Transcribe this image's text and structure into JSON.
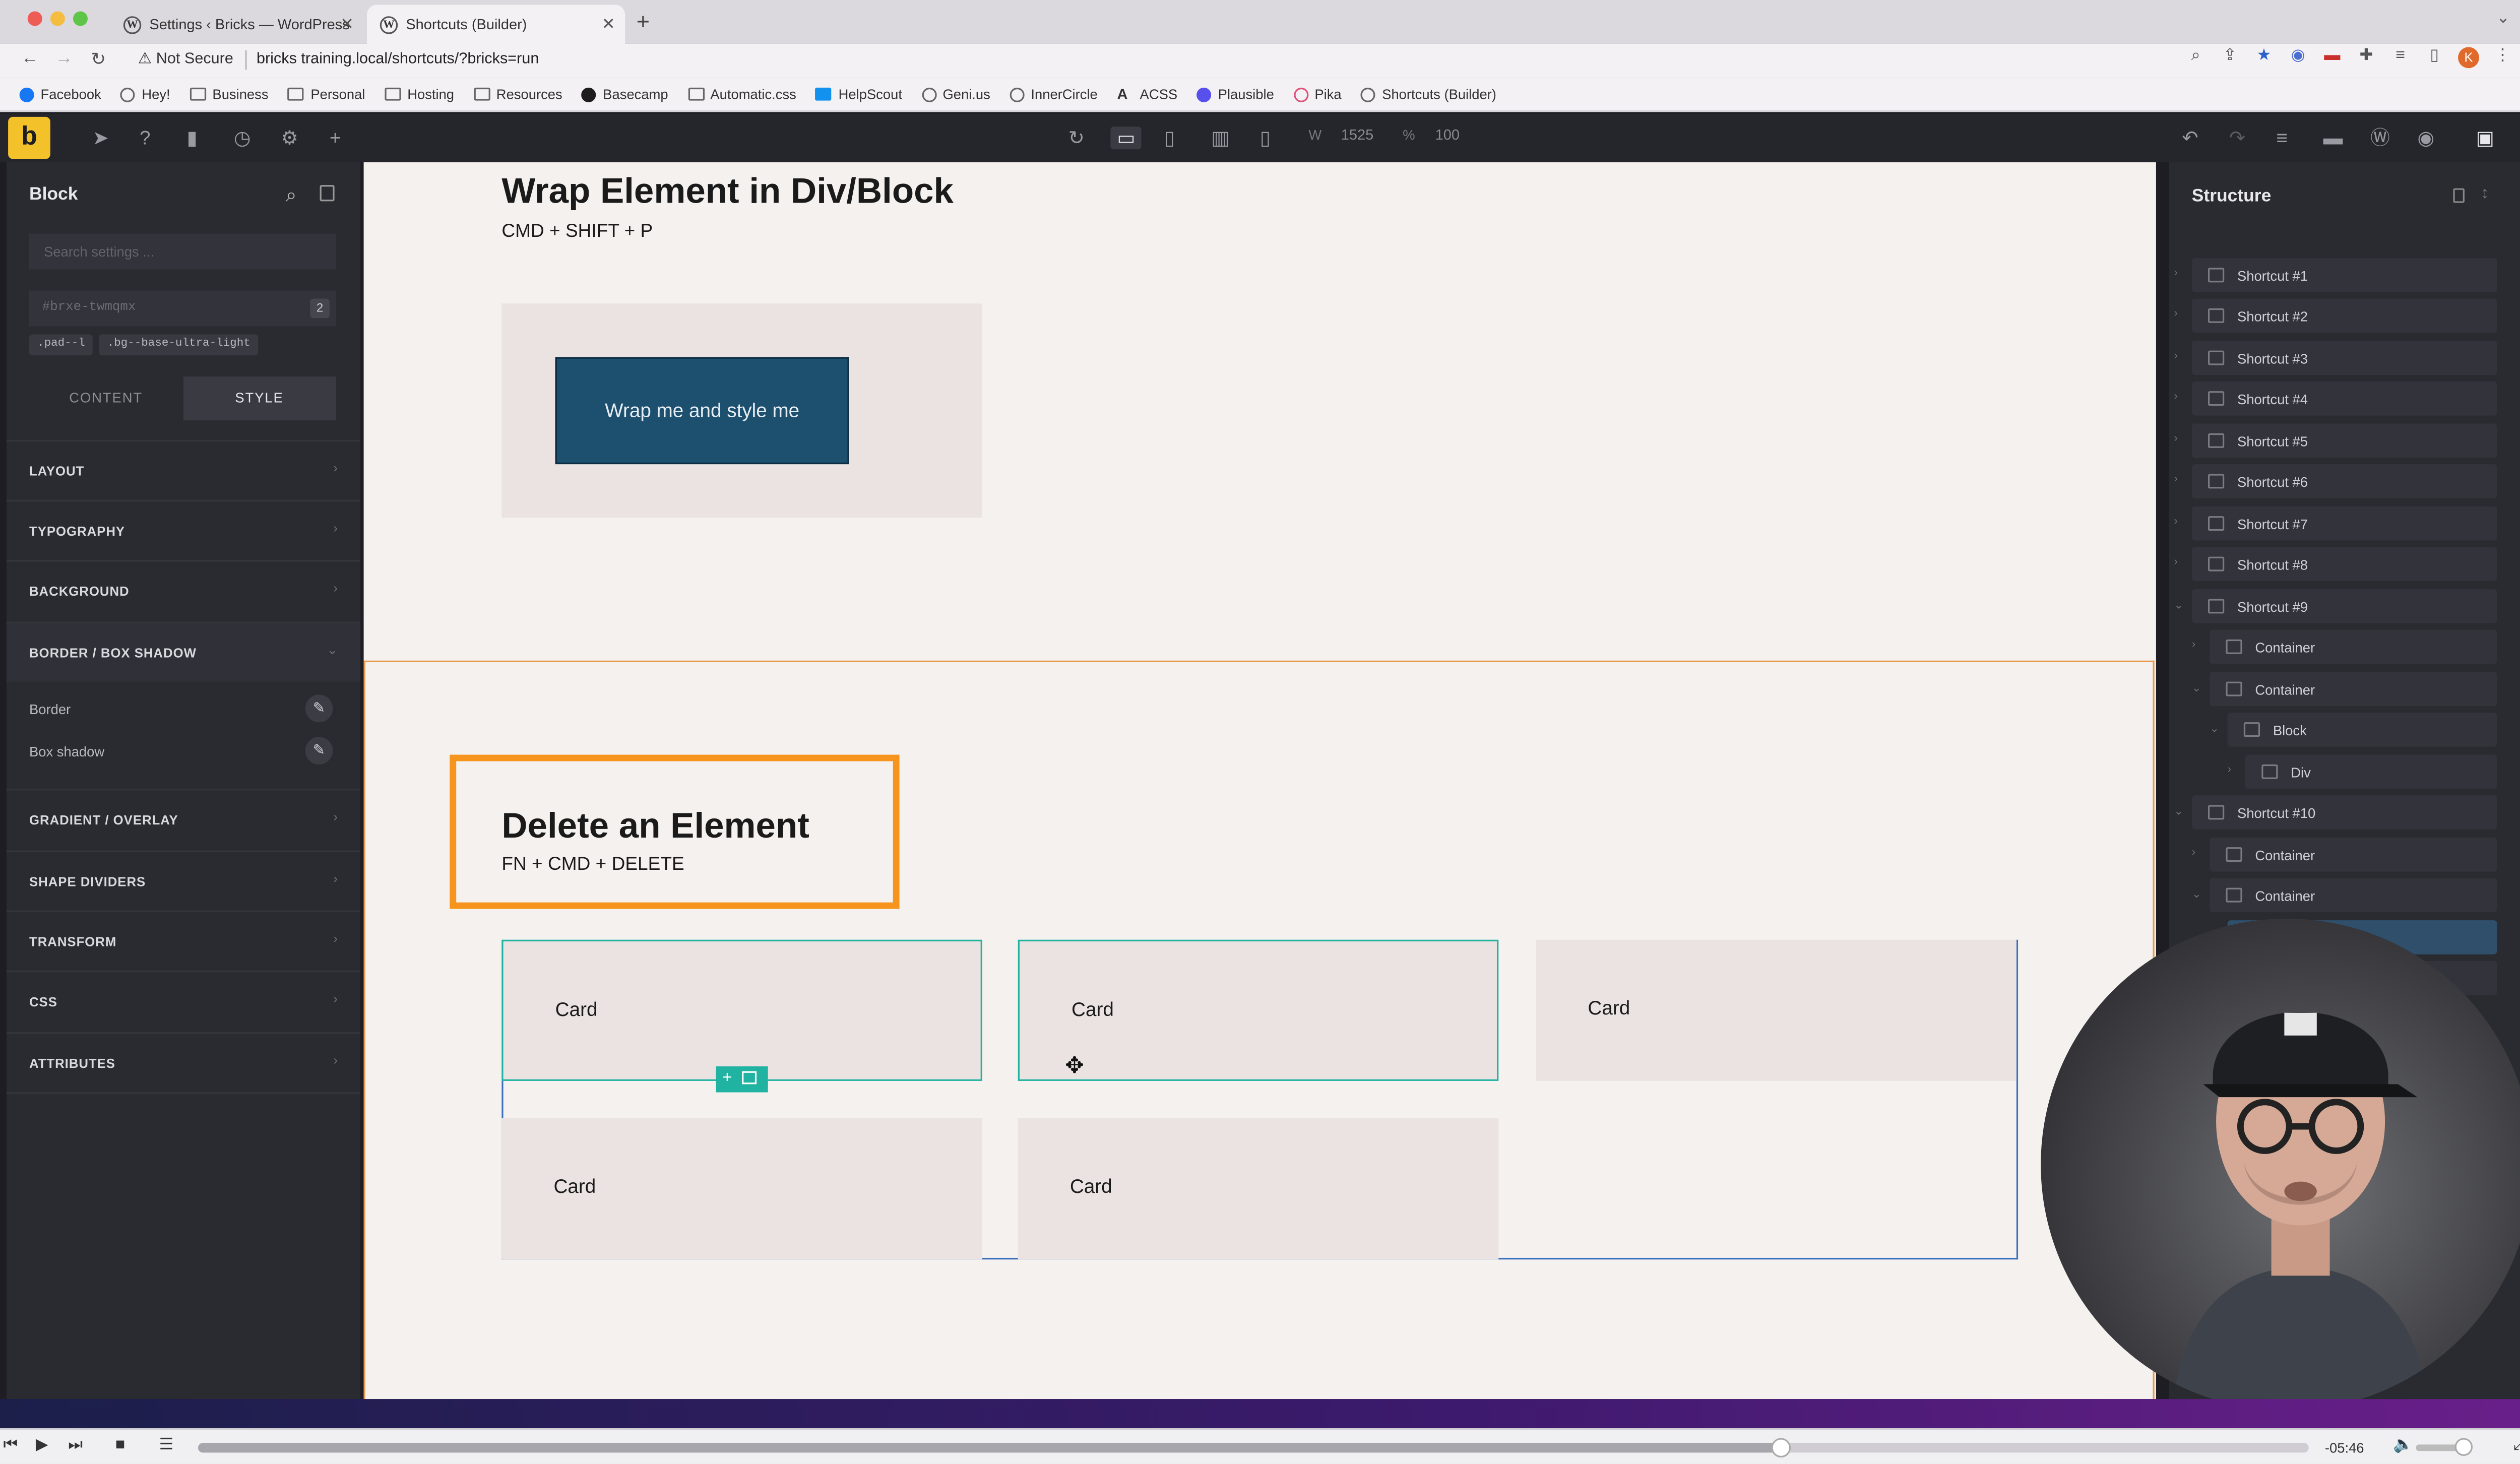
{
  "browser": {
    "tabs": [
      {
        "label": "Settings ‹ Bricks — WordPress"
      },
      {
        "label": "Shortcuts (Builder)"
      }
    ],
    "security_label": "Not Secure",
    "url": "bricks training.local/shortcuts/?bricks=run",
    "bookmarks": [
      {
        "label": "Facebook",
        "icon": "facebook-icon"
      },
      {
        "label": "Hey!",
        "icon": "hey-icon"
      },
      {
        "label": "Business",
        "icon": "folder-icon"
      },
      {
        "label": "Personal",
        "icon": "folder-icon"
      },
      {
        "label": "Hosting",
        "icon": "folder-icon"
      },
      {
        "label": "Resources",
        "icon": "folder-icon"
      },
      {
        "label": "Basecamp",
        "icon": "basecamp-icon"
      },
      {
        "label": "Automatic.css",
        "icon": "folder-icon"
      },
      {
        "label": "HelpScout",
        "icon": "helpscout-icon"
      },
      {
        "label": "Geni.us",
        "icon": "geniuslink-icon"
      },
      {
        "label": "InnerCircle",
        "icon": "circle-icon"
      },
      {
        "label": "ACSS",
        "icon": "acss-icon"
      },
      {
        "label": "Plausible",
        "icon": "plausible-icon"
      },
      {
        "label": "Pika",
        "icon": "pika-icon"
      },
      {
        "label": "Shortcuts (Builder)",
        "icon": "wordpress-icon"
      }
    ]
  },
  "toolbar": {
    "logo": "b",
    "width_label": "W",
    "width_value": "1525",
    "zoom_label": "%",
    "zoom_value": "100"
  },
  "left_panel": {
    "title": "Block",
    "search_placeholder": "Search settings ...",
    "element_id": "#brxe-twmqmx",
    "id_badge": "2",
    "classes": [
      ".pad--l",
      ".bg--base-ultra-light"
    ],
    "tabs": [
      {
        "label": "CONTENT",
        "active": false
      },
      {
        "label": "STYLE",
        "active": true
      }
    ],
    "sections": [
      {
        "label": "LAYOUT"
      },
      {
        "label": "TYPOGRAPHY"
      },
      {
        "label": "BACKGROUND"
      },
      {
        "label": "BORDER / BOX SHADOW"
      },
      {
        "label": "GRADIENT / OVERLAY"
      },
      {
        "label": "SHAPE DIVIDERS"
      },
      {
        "label": "TRANSFORM"
      },
      {
        "label": "CSS"
      },
      {
        "label": "ATTRIBUTES"
      }
    ],
    "border_rows": [
      {
        "label": "Border"
      },
      {
        "label": "Box shadow"
      }
    ]
  },
  "canvas": {
    "wrap_title": "Wrap Element in Div/Block",
    "wrap_shortcut": "CMD + SHIFT + P",
    "wrap_button": "Wrap me and style me",
    "delete_title": "Delete an Element",
    "delete_shortcut": "FN + CMD + DELETE",
    "cards": [
      "Card",
      "Card",
      "Card",
      "Card",
      "Card"
    ]
  },
  "structure": {
    "title": "Structure",
    "items": [
      {
        "label": "Shortcut #1"
      },
      {
        "label": "Shortcut #2"
      },
      {
        "label": "Shortcut #3"
      },
      {
        "label": "Shortcut #4"
      },
      {
        "label": "Shortcut #5"
      },
      {
        "label": "Shortcut #6"
      },
      {
        "label": "Shortcut #7"
      },
      {
        "label": "Shortcut #8"
      },
      {
        "label": "Shortcut #9"
      },
      {
        "label": "Container"
      },
      {
        "label": "Container"
      },
      {
        "label": "Block"
      },
      {
        "label": "Div"
      },
      {
        "label": "Shortcut #10"
      },
      {
        "label": "Container"
      },
      {
        "label": "Container"
      }
    ]
  },
  "player": {
    "time": "-05:46",
    "progress": 0.75
  },
  "colors": {
    "accent_yellow": "#f3c22b",
    "orange_highlight": "#f7941d",
    "teal_selection": "#21b3a1",
    "button_blue": "#1d4f6f"
  }
}
